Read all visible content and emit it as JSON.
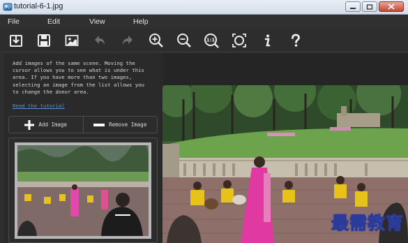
{
  "window": {
    "title": "tutorial-6-1.jpg"
  },
  "menu": {
    "items": [
      {
        "label": "File"
      },
      {
        "label": "Edit"
      },
      {
        "label": "View"
      },
      {
        "label": "Help"
      }
    ]
  },
  "toolbar": {
    "icons": [
      "import-icon",
      "save-icon",
      "image-icon",
      "undo-icon",
      "redo-icon",
      "zoom-in-icon",
      "zoom-out-icon",
      "actual-size-icon",
      "fit-to-window-icon",
      "info-icon",
      "help-icon"
    ],
    "actual_size_label": "1:1"
  },
  "sidebar": {
    "help_text": "Add images of the same scene. Moving the\ncursor allows you to see what is under this\narea. If you have more than two images,\nselecting an image from the list allows you\nto change the donor area.",
    "tutorial_link": "Read the tutorial",
    "add_image_label": "Add Image",
    "remove_image_label": "Remove Image"
  },
  "viewer": {
    "watermark": "最需教育"
  },
  "colors": {
    "background": "#2f2f2f",
    "link": "#5b8fd6",
    "watermark_stroke": "#2a3b9a"
  }
}
